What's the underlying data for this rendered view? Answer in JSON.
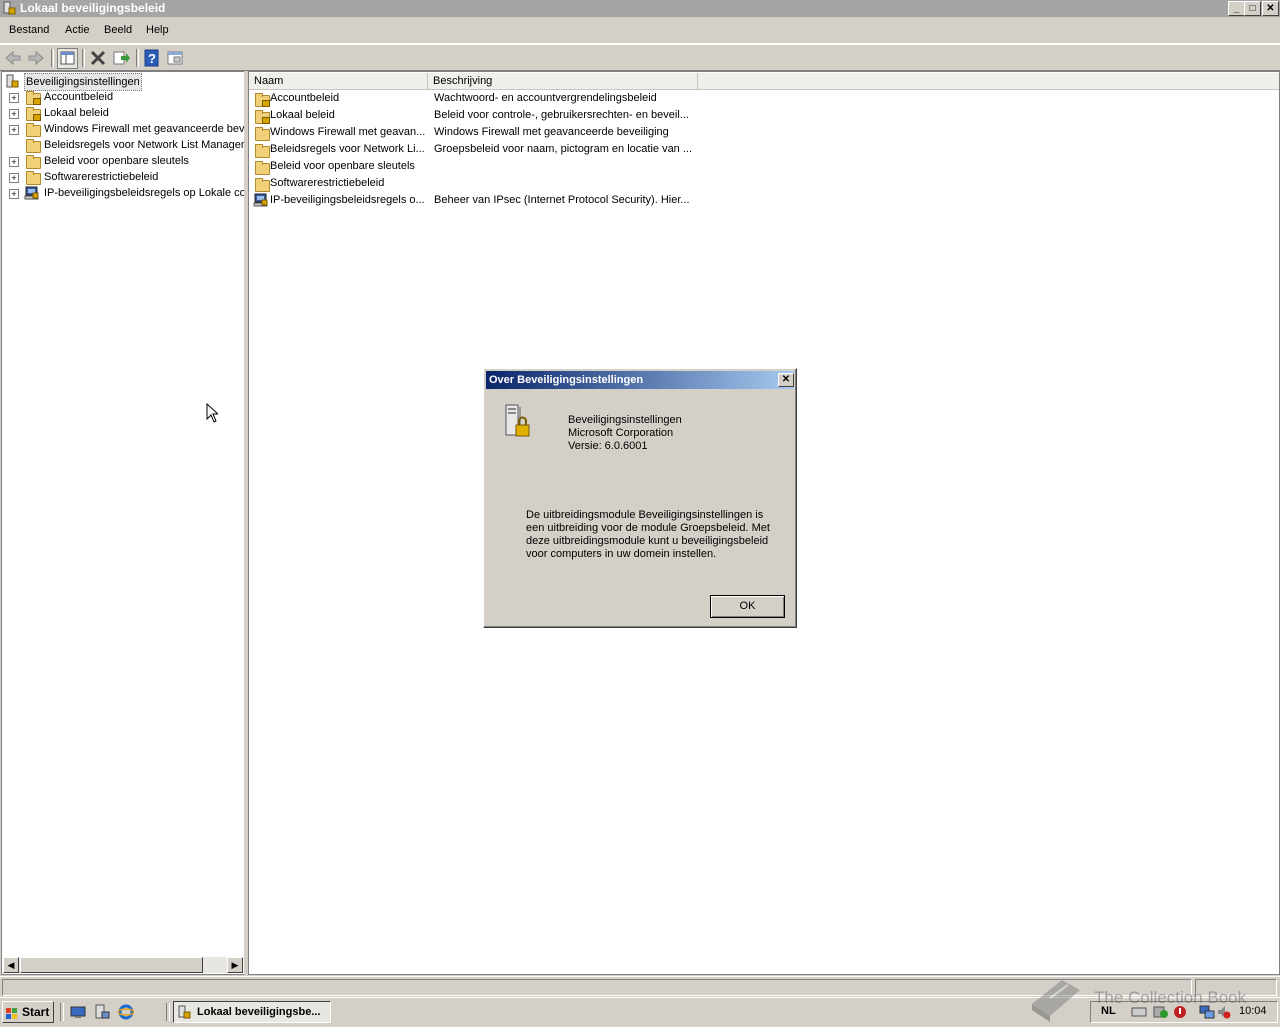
{
  "window": {
    "title": "Lokaal beveiligingsbeleid"
  },
  "menu": [
    "Bestand",
    "Actie",
    "Beeld",
    "Help"
  ],
  "toolbar": {
    "icons": [
      "back-icon",
      "forward-icon",
      "show-hide-tree-icon",
      "delete-icon",
      "export-list-icon",
      "help-icon",
      "properties-icon"
    ]
  },
  "tree": {
    "root": "Beveiligingsinstellingen",
    "items": [
      {
        "label": "Accountbeleid",
        "expandable": true,
        "icon": "locked-folder-icon"
      },
      {
        "label": "Lokaal beleid",
        "expandable": true,
        "icon": "locked-folder-icon"
      },
      {
        "label": "Windows Firewall met geavanceerde bev",
        "expandable": true,
        "icon": "folder-icon"
      },
      {
        "label": "Beleidsregels voor Network List Manager",
        "expandable": false,
        "icon": "folder-icon"
      },
      {
        "label": "Beleid voor openbare sleutels",
        "expandable": true,
        "icon": "folder-icon"
      },
      {
        "label": "Softwarerestrictiebeleid",
        "expandable": true,
        "icon": "folder-icon"
      },
      {
        "label": "IP-beveiligingsbeleidsregels op Lokale con",
        "expandable": true,
        "icon": "ipsec-icon"
      }
    ]
  },
  "list": {
    "columns": [
      "Naam",
      "Beschrijving"
    ],
    "rows": [
      {
        "name": "Accountbeleid",
        "description": "Wachtwoord- en accountvergrendelingsbeleid",
        "icon": "locked-folder-icon"
      },
      {
        "name": "Lokaal beleid",
        "description": "Beleid voor controle-, gebruikersrechten- en beveil...",
        "icon": "locked-folder-icon"
      },
      {
        "name": "Windows Firewall met geavan...",
        "description": "Windows Firewall met geavanceerde beveiliging",
        "icon": "folder-icon"
      },
      {
        "name": "Beleidsregels voor Network Li...",
        "description": "Groepsbeleid voor naam, pictogram en locatie van ...",
        "icon": "folder-icon"
      },
      {
        "name": "Beleid voor openbare sleutels",
        "description": "",
        "icon": "folder-icon"
      },
      {
        "name": "Softwarerestrictiebeleid",
        "description": "",
        "icon": "folder-icon"
      },
      {
        "name": "IP-beveiligingsbeleidsregels o...",
        "description": "Beheer van IPsec (Internet Protocol Security). Hier...",
        "icon": "ipsec-icon"
      }
    ]
  },
  "dialog": {
    "title": "Over Beveiligingsinstellingen",
    "product": "Beveiligingsinstellingen",
    "company": "Microsoft Corporation",
    "version": "Versie: 6.0.6001",
    "description_lines": [
      "De uitbreidingsmodule Beveiligingsinstellingen is",
      "een uitbreiding voor de module Groepsbeleid. Met",
      "deze uitbreidingsmodule kunt u beveiligingsbeleid",
      "voor computers in uw domein instellen."
    ],
    "ok_label": "OK"
  },
  "taskbar": {
    "start_label": "Start",
    "task_label": "Lokaal beveiligingsbe...",
    "language": "NL",
    "clock": "10:04"
  },
  "watermark": "The Collection Book",
  "colors": {
    "dialog_title_start": "#0a246a",
    "dialog_title_end": "#a6caf0",
    "folder": "#f0d078"
  }
}
